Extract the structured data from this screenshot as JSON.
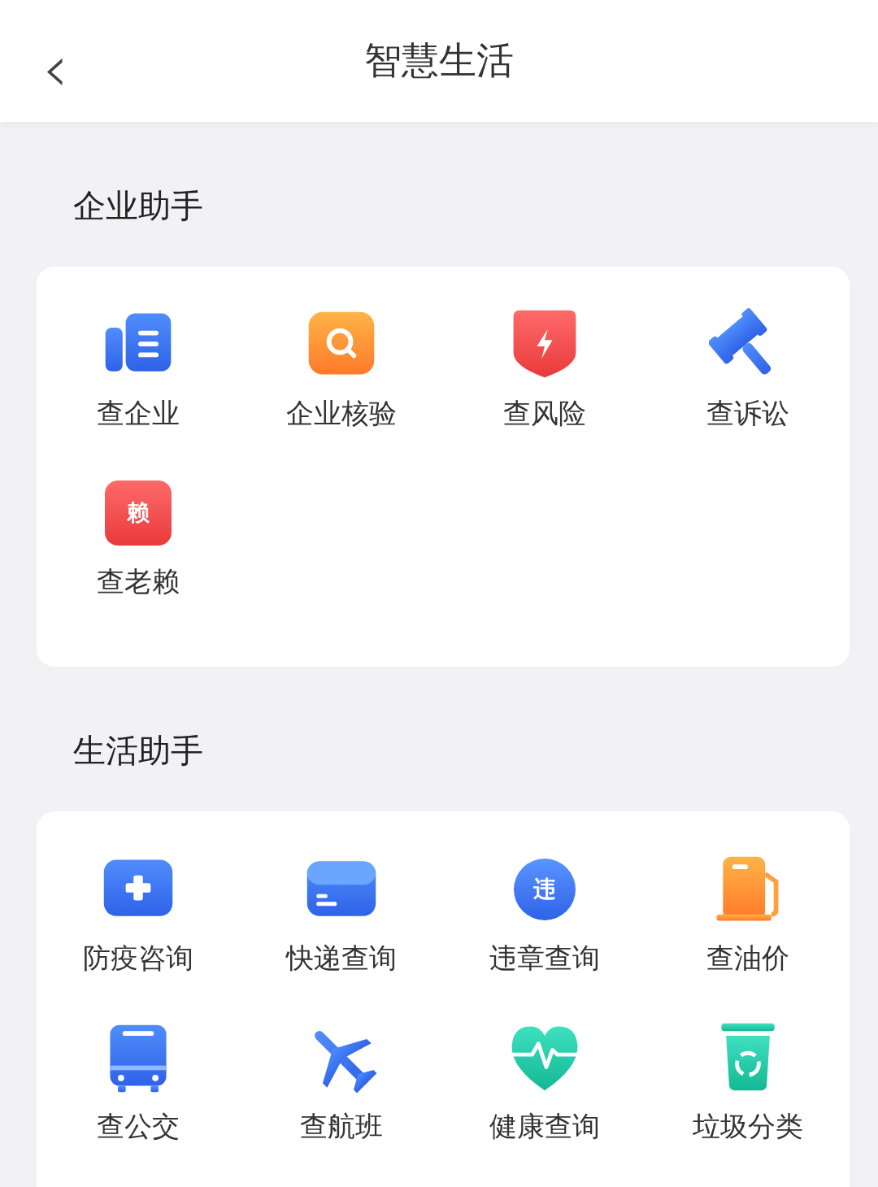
{
  "header": {
    "back_icon": "‹",
    "title": "智慧生活"
  },
  "sections": [
    {
      "title": "企业助手",
      "items": [
        {
          "label": "查企业",
          "kind": "document"
        },
        {
          "label": "企业核验",
          "kind": "search"
        },
        {
          "label": "查风险",
          "kind": "risk"
        },
        {
          "label": "查诉讼",
          "kind": "gavel"
        },
        {
          "label": "查老赖",
          "kind": "character",
          "icon_text": "赖"
        }
      ]
    },
    {
      "title": "生活助手",
      "items": [
        {
          "label": "防疫咨询",
          "kind": "medical"
        },
        {
          "label": "快递查询",
          "kind": "parcel"
        },
        {
          "label": "违章查询",
          "kind": "violation",
          "icon_text": "违"
        },
        {
          "label": "查油价",
          "kind": "fuel"
        },
        {
          "label": "查公交",
          "kind": "bus"
        },
        {
          "label": "查航班",
          "kind": "plane"
        },
        {
          "label": "健康查询",
          "kind": "heart"
        },
        {
          "label": "垃圾分类",
          "kind": "trash"
        }
      ]
    }
  ]
}
